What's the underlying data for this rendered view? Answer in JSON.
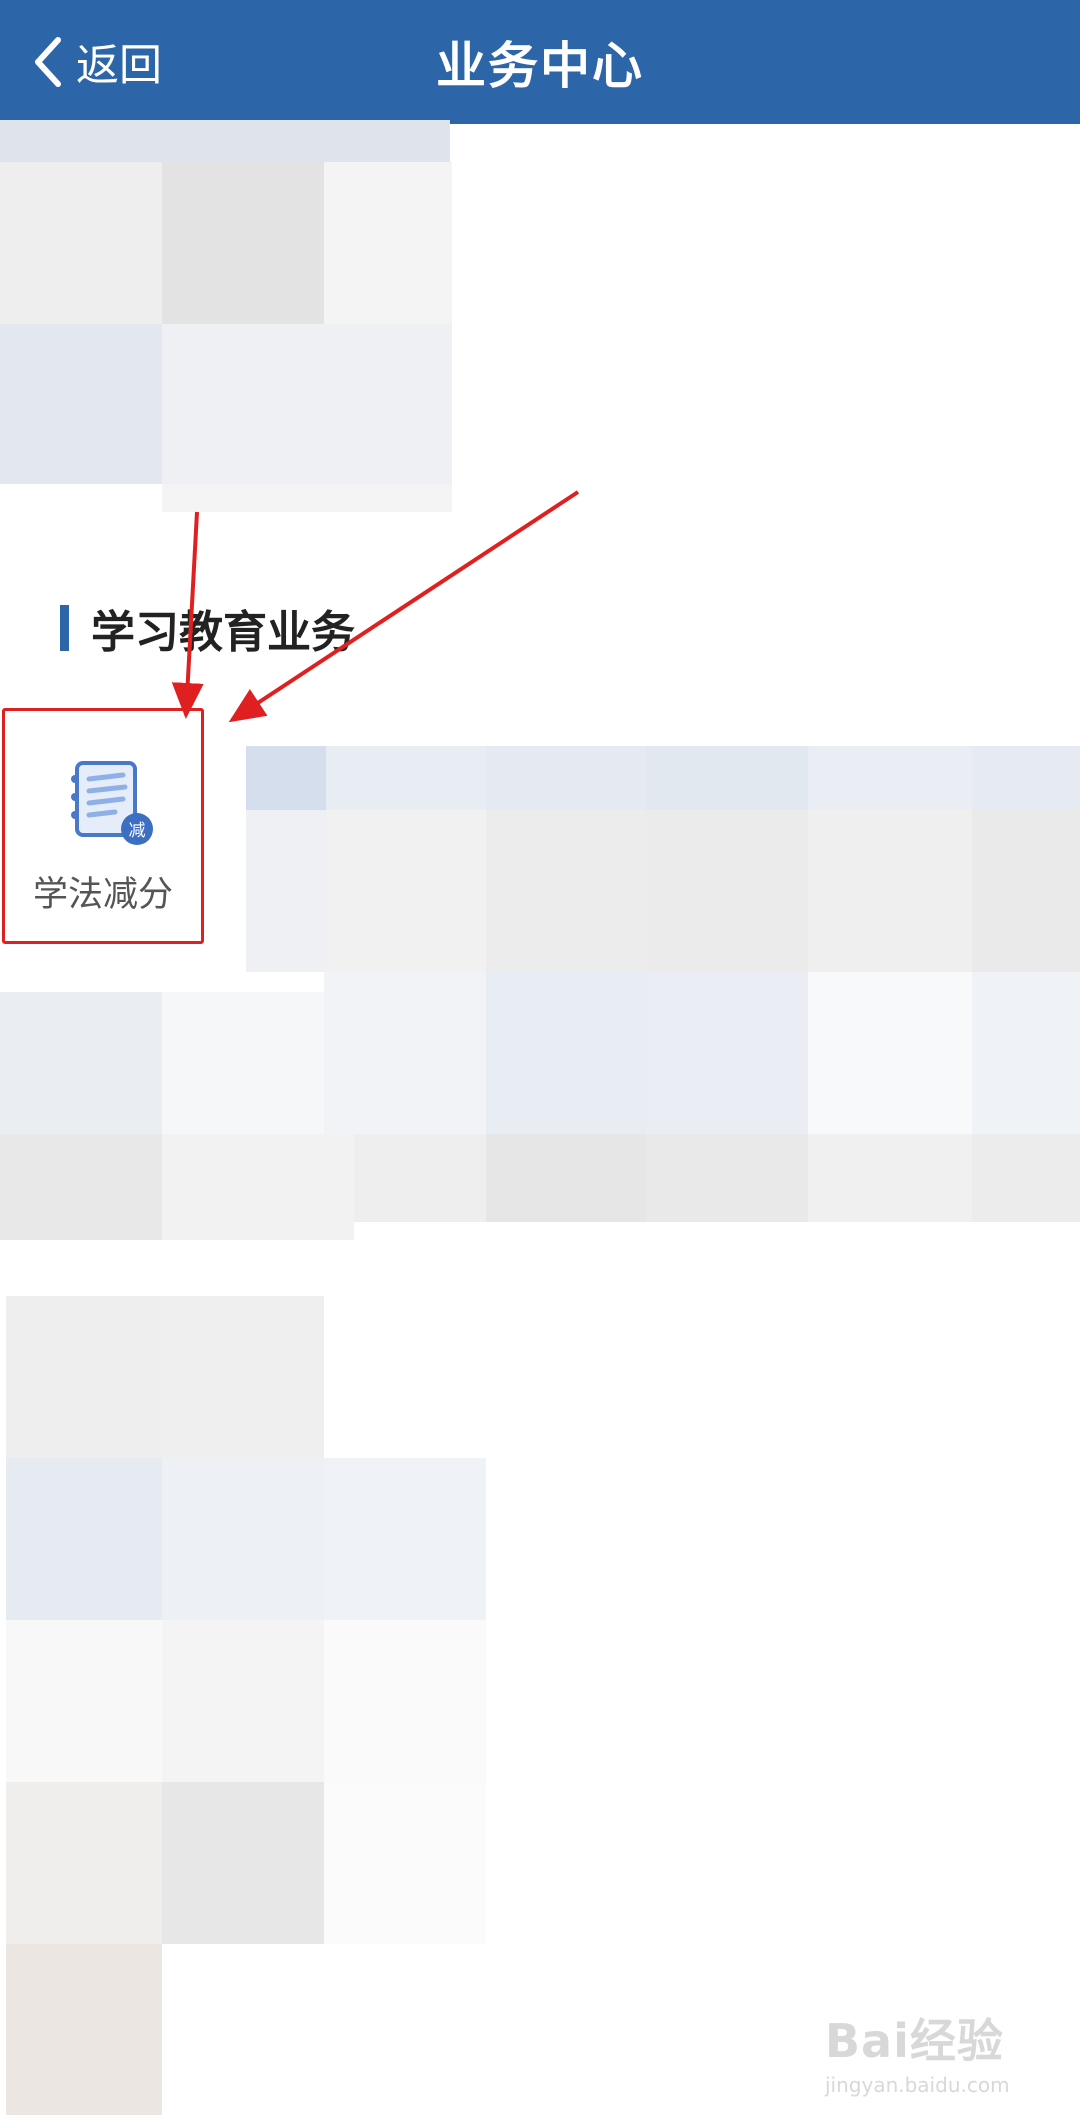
{
  "header": {
    "back_label": "返回",
    "title": "业务中心",
    "background_color": "#2d66a8"
  },
  "section": {
    "title": "学习教育业务"
  },
  "services": [
    {
      "label": "学法减分",
      "icon": "notebook-icon",
      "badge": "减"
    }
  ],
  "annotation": {
    "highlight_color": "#e02020"
  },
  "watermark": {
    "text": "Bai经验",
    "sub": "jingyan.baidu.com"
  }
}
